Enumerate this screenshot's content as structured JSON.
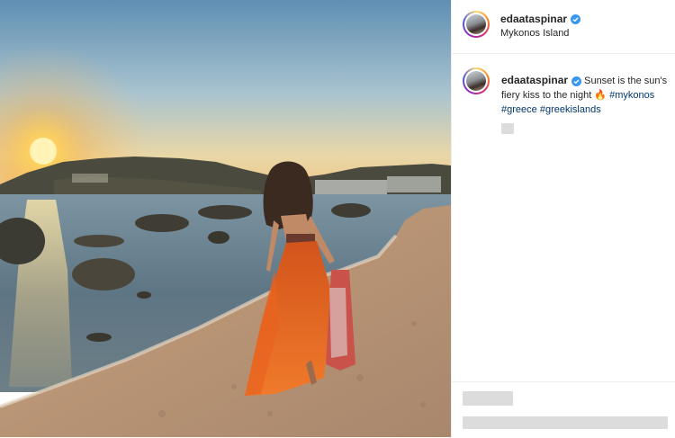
{
  "post": {
    "username": "edaataspinar",
    "location": "Mykonos Island",
    "caption": {
      "username": "edaataspinar",
      "text": "Sunset is the sun's fiery kiss to the night",
      "emoji": "🔥",
      "hashtags": [
        "#mykonos",
        "#greece",
        "#greekislands"
      ]
    }
  },
  "icons": {
    "verified": "verified-badge-icon",
    "avatar": "profile-avatar"
  },
  "colors": {
    "hashtag": "#00376b",
    "verified": "#3897f0",
    "text": "#262626",
    "border": "#efefef"
  }
}
